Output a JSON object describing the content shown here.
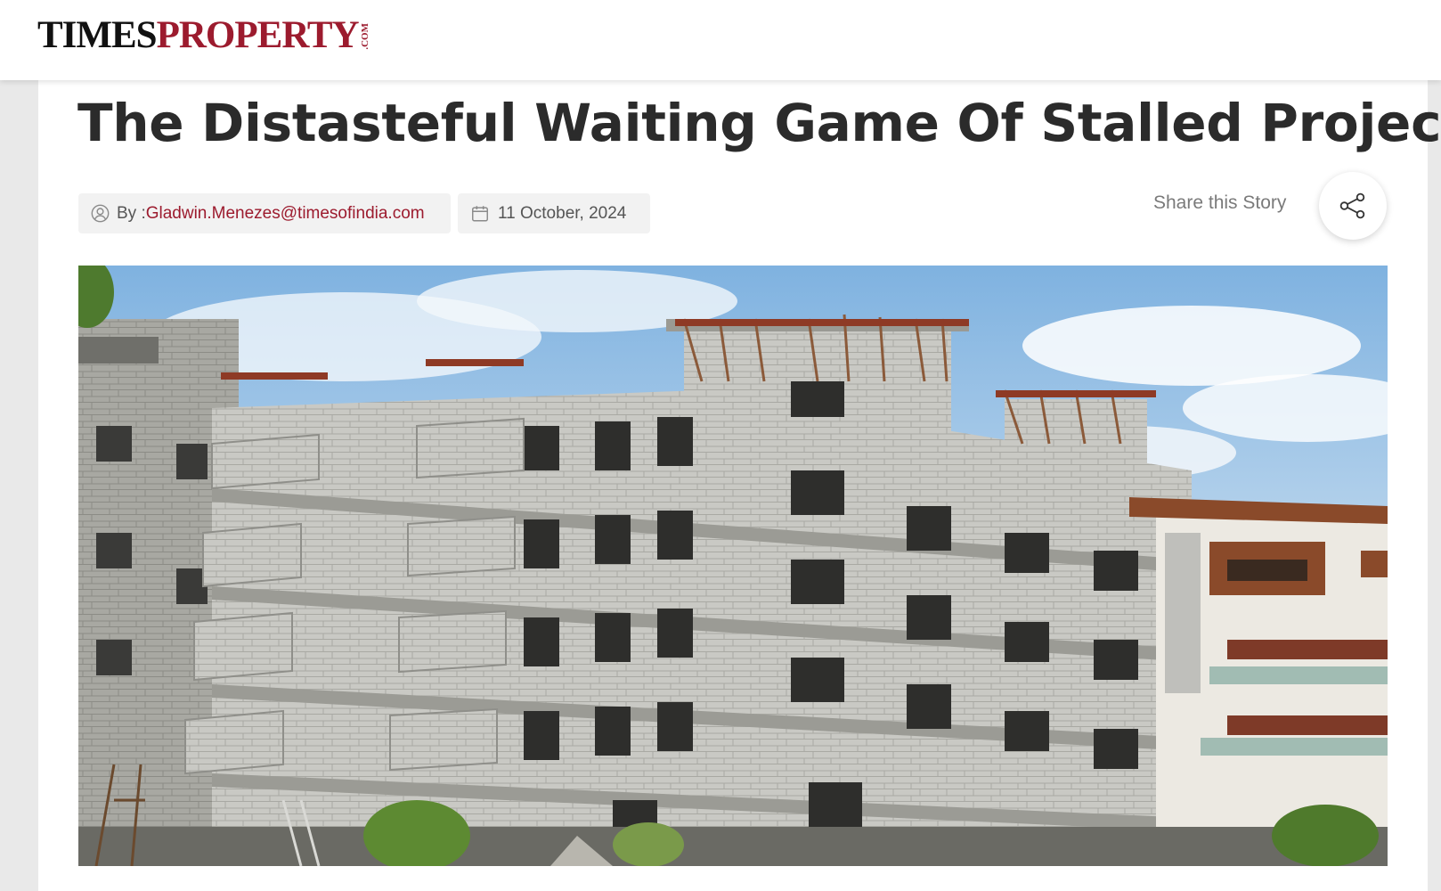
{
  "header": {
    "logo": {
      "part1": "TIMES",
      "part2": "PROPERTY",
      "suffix": ".COM"
    }
  },
  "article": {
    "title": "The Distasteful Waiting Game Of Stalled Projects",
    "author_prefix": "By :",
    "author": "Gladwin.Menezes@timesofindia.com",
    "date": "11 October, 2024",
    "share_label": "Share this Story"
  },
  "icons": {
    "author": "user-circle-icon",
    "date": "calendar-icon",
    "share": "share-icon"
  },
  "colors": {
    "brand_red": "#9c1b2e",
    "headline": "#2b2b2b",
    "page_background": "#e9e9e9"
  }
}
